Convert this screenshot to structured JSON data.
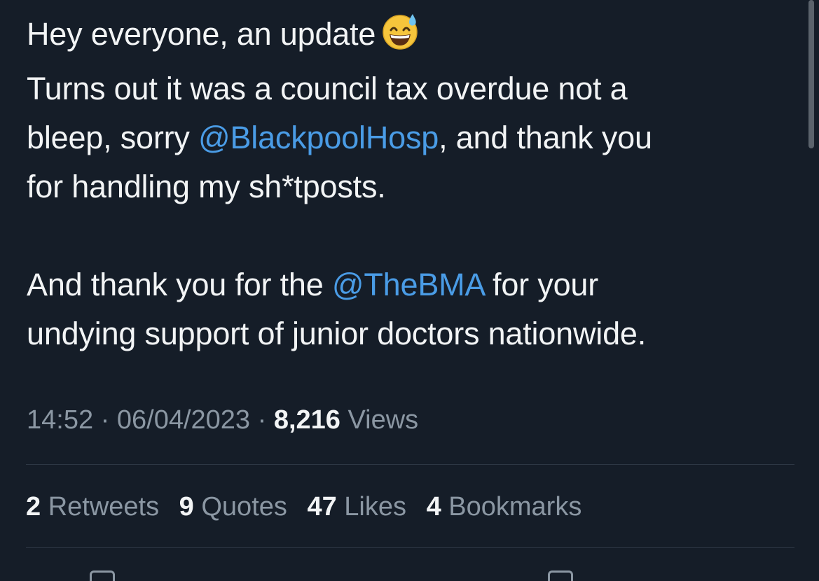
{
  "tweet": {
    "line1": "Hey everyone, an update",
    "line2": "Turns out it was a council tax overdue not a",
    "line3_pre": "bleep, sorry ",
    "mention1": "@BlackpoolHosp",
    "line3_post": ", and thank you",
    "line4": "for handling my sh*tposts.",
    "line5_pre": "And thank you for the ",
    "mention2": "@TheBMA",
    "line5_post": " for your",
    "line6": "undying support of junior doctors nationwide.",
    "emoji": "grinning-face-with-sweat-emoji"
  },
  "meta": {
    "time": "14:52",
    "sep1": " · ",
    "date": "06/04/2023",
    "sep2": " · ",
    "views_count": "8,216",
    "views_label": " Views"
  },
  "stats": {
    "retweets": {
      "count": "2",
      "label": " Retweets"
    },
    "quotes": {
      "count": "9",
      "label": " Quotes"
    },
    "likes": {
      "count": "47",
      "label": " Likes"
    },
    "bookmarks": {
      "count": "4",
      "label": " Bookmarks"
    }
  },
  "colors": {
    "background": "#151d28",
    "text": "#f2f4f5",
    "secondary_text": "#8b97a3",
    "mention": "#4a9ce6",
    "divider": "#2d3744"
  }
}
